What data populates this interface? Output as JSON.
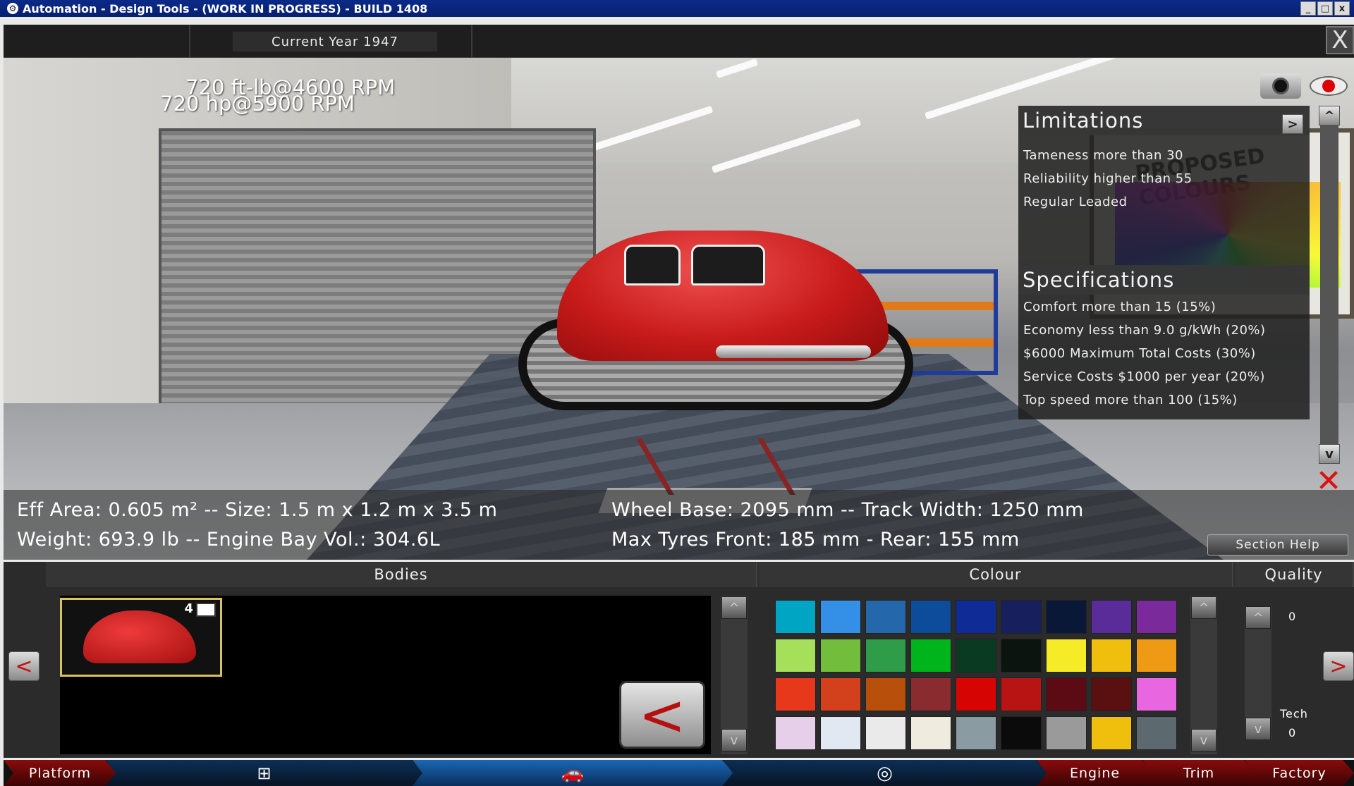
{
  "window": {
    "title": "Automation - Design Tools - (WORK IN PROGRESS) - BUILD 1408",
    "buttons": [
      "_",
      "□",
      "x"
    ]
  },
  "header": {
    "current_year": "Current Year 1947",
    "close_label": "X"
  },
  "scene": {
    "torque": "720 ft-lb@4600 RPM",
    "power": "720 hp@5900 RPM",
    "eff_area": "Eff Area: 0.605 m² -- Size: 1.5 m x 1.2 m x 3.5 m",
    "weight": "Weight: 693.9 lb -- Engine Bay Vol.: 304.6L",
    "wheel_base": "Wheel Base: 2095 mm -- Track Width: 1250 mm",
    "tyres": "Max Tyres Front: 185 mm - Rear: 155 mm",
    "poster_text": "PROPOSED COLOURS"
  },
  "limitations": {
    "title": "Limitations",
    "items": [
      "Tameness more than 30",
      "Reliability higher than 55",
      "Regular Leaded"
    ]
  },
  "specifications": {
    "title": "Specifications",
    "items": [
      "Comfort more than 15 (15%)",
      "Economy less than 9.0 g/kWh (20%)",
      "$6000 Maximum Total Costs (30%)",
      "Service Costs $1000 per year (20%)",
      "Top speed more than 100 (15%)"
    ]
  },
  "panel_controls": {
    "expand": ">",
    "up": "^",
    "down": "v",
    "section_help": "Section Help"
  },
  "bodies": {
    "header": "Bodies",
    "selected_doors": "4",
    "prev": "<",
    "back": "<",
    "up": "^",
    "down": "v"
  },
  "colour": {
    "header": "Colour",
    "up": "^",
    "down": "v",
    "swatches": [
      [
        "#00a5c4",
        "#3390e6",
        "#2467ab",
        "#0c4c9b",
        "#0f2c96",
        "#171f5c",
        "#0a1838",
        "#5a2c9a",
        "#7a2a9a"
      ],
      [
        "#a6e05a",
        "#72be3c",
        "#2f9c4a",
        "#00b41c",
        "#0b3a22",
        "#0c140f",
        "#f5ec27",
        "#f0be0c",
        "#ef9a14"
      ],
      [
        "#e8381c",
        "#d2401c",
        "#b8500c",
        "#8a2c2f",
        "#d70404",
        "#b81414",
        "#5c0a14",
        "#5a1010",
        "#e866e0"
      ],
      [
        "#e6cfe9",
        "#e2e8f2",
        "#eaeaea",
        "#efebdf",
        "#8a9ba2",
        "#0b0b0b",
        "#9a9a9a",
        "#f0be0c",
        "#5c6a70"
      ]
    ]
  },
  "quality": {
    "header": "Quality",
    "value": "0",
    "tech_label": "Tech",
    "tech_value": "0",
    "up": "^",
    "down": "v",
    "next": ">"
  },
  "nav": {
    "items": [
      "Platform",
      "",
      "",
      "",
      "Engine",
      "Trim",
      "Factory"
    ]
  },
  "colors": {
    "accent_red": "#8a0b0b",
    "accent_blue": "#1a67b4",
    "title_bar": "#0b2a88"
  }
}
